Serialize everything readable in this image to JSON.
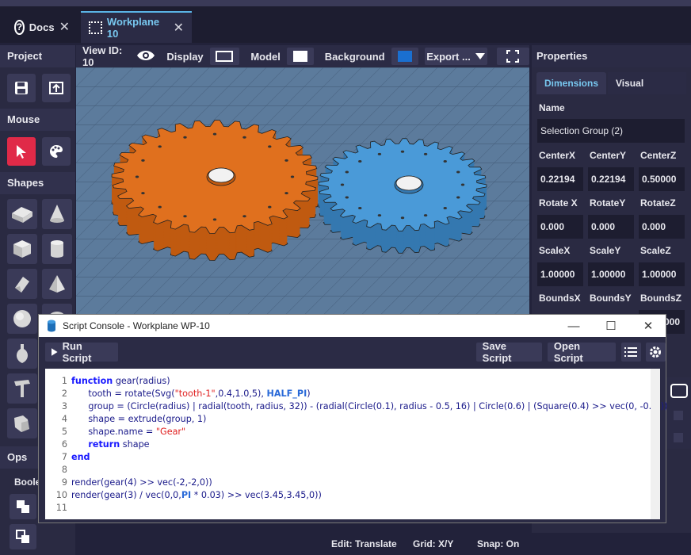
{
  "tabs": [
    {
      "label": "Docs",
      "icon": "help-circle-icon"
    },
    {
      "label": "Workplane 10",
      "icon": "grid-dots-icon"
    }
  ],
  "left_panel": {
    "project_header": "Project",
    "mouse_header": "Mouse",
    "shapes_header": "Shapes",
    "ops_header": "Ops",
    "ops_sub": "Boole"
  },
  "view_toolbar": {
    "view_id_label": "View ID: 10",
    "display_label": "Display",
    "model_label": "Model",
    "background_label": "Background",
    "export_label": "Export ...",
    "background_color": "#1a6fd0"
  },
  "properties": {
    "header": "Properties",
    "tabs": [
      "Dimensions",
      "Visual"
    ],
    "name_label": "Name",
    "name_value": "Selection Group (2)",
    "center_labels": [
      "CenterX",
      "CenterY",
      "CenterZ"
    ],
    "center_values": [
      "0.22194",
      "0.22194",
      "0.50000"
    ],
    "rotate_labels": [
      "Rotate X",
      "RotateY",
      "RotateZ"
    ],
    "rotate_values": [
      "0.000",
      "0.000",
      "0.000"
    ],
    "scale_labels": [
      "ScaleX",
      "ScaleY",
      "ScaleZ"
    ],
    "scale_values": [
      "1.00000",
      "1.00000",
      "1.00000"
    ],
    "bounds_labels": [
      "BoundsX",
      "BoundsY",
      "BoundsZ"
    ],
    "bounds_partial_value": "000"
  },
  "console": {
    "title": "Script Console - Workplane WP-10",
    "run_label": "Run Script",
    "save_label": "Save Script",
    "open_label": "Open Script",
    "line_numbers": [
      "1",
      "2",
      "3",
      "4",
      "5",
      "6",
      "7",
      "8",
      "9",
      "10",
      "11"
    ]
  },
  "status": {
    "edit": "Edit: Translate",
    "grid": "Grid: X/Y",
    "snap": "Snap: On"
  },
  "colors": {
    "gear_orange": "#e0701e",
    "gear_blue": "#4a9ad8",
    "accent_tab": "#78c8f0",
    "active_tool": "#e02a48"
  }
}
